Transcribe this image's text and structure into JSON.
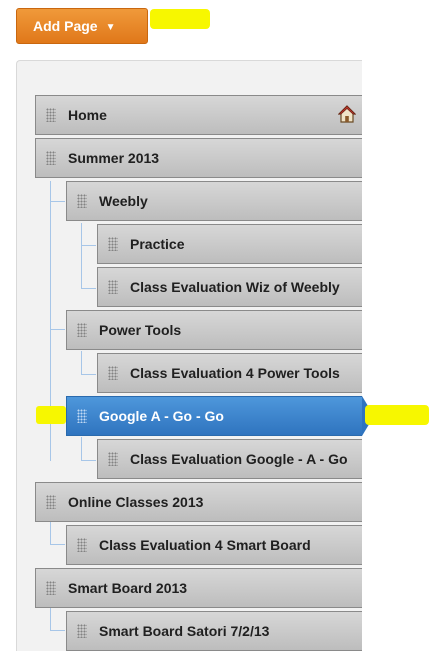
{
  "toolbar": {
    "add_page_label": "Add Page"
  },
  "pages": [
    {
      "label": "Home",
      "level": 0,
      "icon": "home-icon"
    },
    {
      "label": "Summer 2013",
      "level": 0
    },
    {
      "label": "Weebly",
      "level": 1
    },
    {
      "label": "Practice",
      "level": 2
    },
    {
      "label": "Class Evaluation Wiz of Weebly",
      "level": 2
    },
    {
      "label": "Power Tools",
      "level": 1
    },
    {
      "label": "Class Evaluation 4 Power Tools",
      "level": 2
    },
    {
      "label": "Google A - Go - Go",
      "level": 1,
      "selected": true
    },
    {
      "label": "Class Evaluation Google - A - Go",
      "level": 2
    },
    {
      "label": "Online Classes 2013",
      "level": 0
    },
    {
      "label": "Class Evaluation 4 Smart Board",
      "level": 1
    },
    {
      "label": "Smart Board 2013",
      "level": 0
    },
    {
      "label": "Smart Board Satori 7/2/13",
      "level": 1
    }
  ],
  "colors": {
    "accent_orange": "#e8841f",
    "selected_blue": "#3a82cc",
    "highlight_yellow": "#f7f700",
    "arrow_green": "#3c8c1c"
  }
}
